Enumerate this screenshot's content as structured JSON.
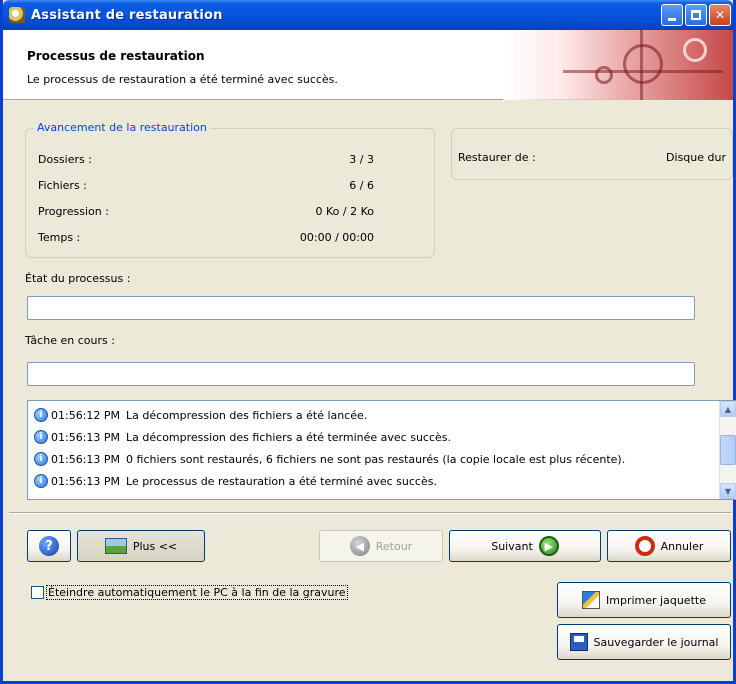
{
  "window": {
    "title": "Assistant de restauration"
  },
  "header": {
    "title": "Processus de restauration",
    "subtitle": "Le processus de restauration a été terminé avec succès."
  },
  "progress_group": {
    "legend": "Avancement de la restauration",
    "rows": [
      {
        "label": "Dossiers :",
        "value": "3 / 3"
      },
      {
        "label": "Fichiers :",
        "value": "6 / 6"
      },
      {
        "label": "Progression :",
        "value": "0 Ko  / 2 Ko"
      },
      {
        "label": "Temps :",
        "value": "00:00  / 00:00"
      }
    ]
  },
  "source_group": {
    "label": "Restaurer de :",
    "value": "Disque dur"
  },
  "process_state": {
    "label": "État du processus :",
    "value": ""
  },
  "current_task": {
    "label": "Tâche en cours :",
    "value": ""
  },
  "log": [
    {
      "time": "01:56:12 PM",
      "message": "La décompression des fichiers a été lancée."
    },
    {
      "time": "01:56:13 PM",
      "message": "La décompression des fichiers a été terminée avec succès."
    },
    {
      "time": "01:56:13 PM",
      "message": "0 fichiers sont restaurés, 6 fichiers ne sont pas restaurés (la copie locale est plus récente)."
    },
    {
      "time": "01:56:13 PM",
      "message": "Le processus de restauration a été terminé avec succès."
    }
  ],
  "buttons": {
    "more": "Plus <<",
    "back": "Retour",
    "next": "Suivant",
    "cancel": "Annuler",
    "print_cover": "Imprimer jaquette",
    "save_log": "Sauvegarder le journal"
  },
  "shutdown_checkbox": {
    "label": "Éteindre automatiquement le PC à la fin de la gravure",
    "checked": false
  },
  "colors": {
    "titlebar": "#0655e0",
    "legend": "#0046d5",
    "window_bg": "#ece9d8"
  }
}
